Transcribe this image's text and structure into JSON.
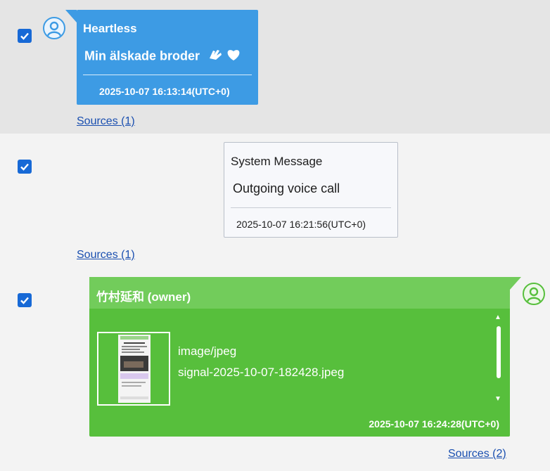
{
  "messages": [
    {
      "sender": "Heartless",
      "text": "Min älskade broder",
      "timestamp": "2025-10-07 16:13:14(UTC+0)",
      "sources": "Sources (1)",
      "checked": true
    },
    {
      "title": "System Message",
      "text": "Outgoing voice call",
      "timestamp": "2025-10-07 16:21:56(UTC+0)",
      "sources": "Sources (1)",
      "checked": true
    },
    {
      "sender": "竹村延和 (owner)",
      "attachment": {
        "mime_type": "image/jpeg",
        "filename": "signal-2025-10-07-182428.jpeg"
      },
      "timestamp": "2025-10-07 16:24:28(UTC+0)",
      "sources": "Sources (2)",
      "checked": true
    }
  ],
  "colors": {
    "incoming": "#3d9be4",
    "outgoing": "#57bf3c",
    "outgoing_header": "#72cc5b",
    "checkbox": "#1769d6",
    "link": "#1a4fb0"
  },
  "icons": {
    "emojis": [
      "wave-hand-icon",
      "white-heart-icon"
    ],
    "avatar": "user-avatar-icon"
  }
}
